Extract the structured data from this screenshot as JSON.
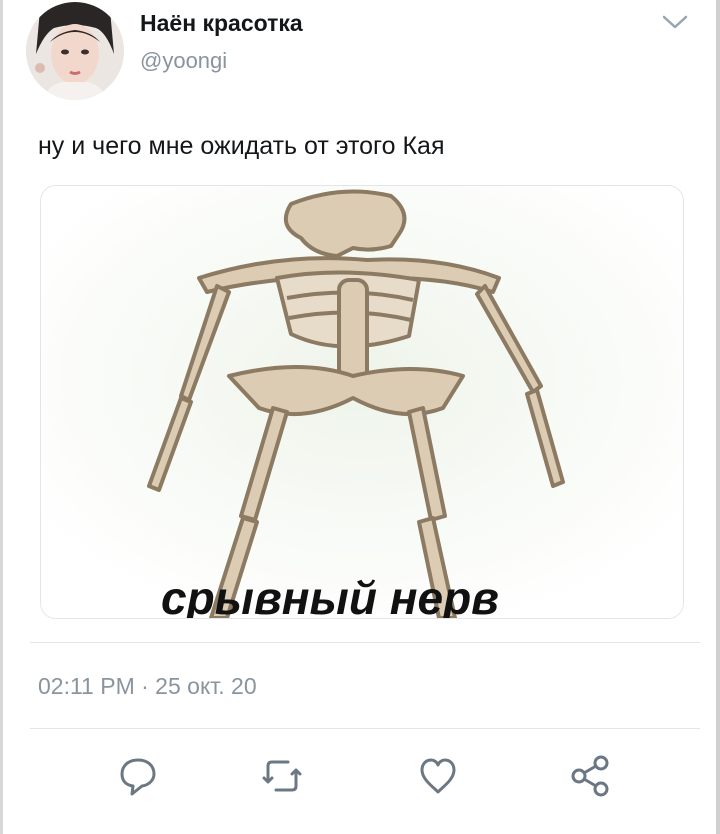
{
  "tweet": {
    "display_name": "Наён красотка",
    "handle": "@yoongi",
    "text": "ну и чего мне ожидать от этого Кая",
    "media_caption": "срывный нерв",
    "timestamp": "02:11 PM · 25 окт. 20"
  },
  "icons": {
    "menu": "chevron-down-icon",
    "reply": "reply-icon",
    "retweet": "retweet-icon",
    "like": "heart-icon",
    "share": "share-icon"
  },
  "colors": {
    "text": "#14171a",
    "secondary": "#8a949e",
    "icon": "#6b7884",
    "divider": "#e3e6e9"
  }
}
